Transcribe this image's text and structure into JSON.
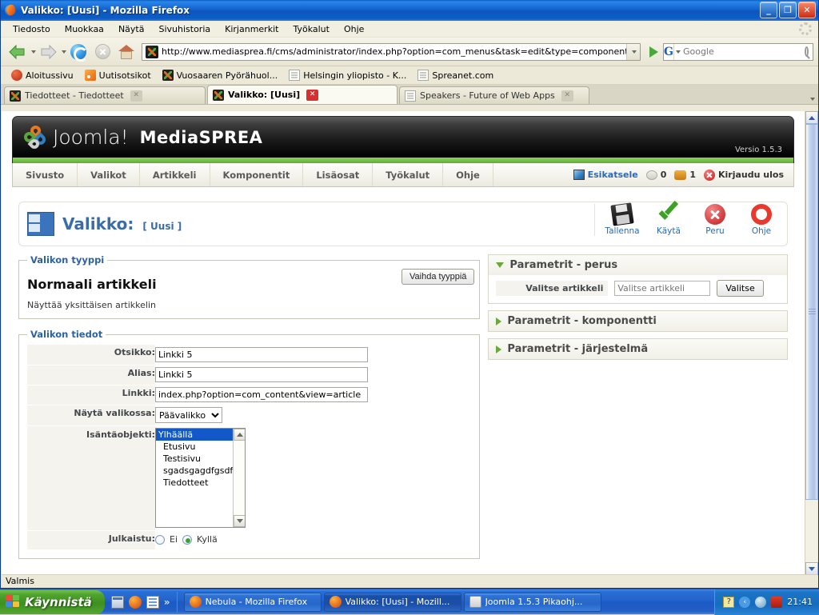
{
  "window": {
    "title": "Valikko: [Uusi] - Mozilla Firefox",
    "minimize": "_",
    "maximize": "❐",
    "close": "✕"
  },
  "menubar": [
    {
      "label": "Tiedosto"
    },
    {
      "label": "Muokkaa"
    },
    {
      "label": "Näytä"
    },
    {
      "label": "Sivuhistoria"
    },
    {
      "label": "Kirjanmerkit"
    },
    {
      "label": "Työkalut"
    },
    {
      "label": "Ohje"
    }
  ],
  "navbar": {
    "back_icon": "back-arrow-icon",
    "forward_icon": "forward-arrow-icon",
    "reload_icon": "reload-icon",
    "stop_icon": "stop-icon",
    "home_icon": "home-icon",
    "url": "http://www.mediasprea.fi/cms/administrator/index.php?option=com_menus&task=edit&type=component&u",
    "go_icon": "go-icon",
    "search_engine": "G",
    "search_placeholder": "Google",
    "search_value": ""
  },
  "bookmarks": [
    {
      "label": "Aloitussivu",
      "icon": "fire-icon"
    },
    {
      "label": "Uutisotsikot",
      "icon": "rss-icon"
    },
    {
      "label": "Vuosaaren Pyörähuol...",
      "icon": "joomla-icon"
    },
    {
      "label": "Helsingin yliopisto - K...",
      "icon": "page-icon"
    },
    {
      "label": "Spreanet.com",
      "icon": "page-icon"
    }
  ],
  "tabs": [
    {
      "label": "Tiedotteet - Tiedotteet",
      "active": false,
      "icon": "joomla-icon"
    },
    {
      "label": "Valikko: [Uusi]",
      "active": true,
      "icon": "joomla-icon"
    },
    {
      "label": "Speakers - Future of Web Apps",
      "active": false,
      "icon": "page-icon"
    }
  ],
  "joomla": {
    "logo_text": "Joomla!",
    "site_name": "MediaSPREA",
    "version": "Versio 1.5.3",
    "nav": [
      {
        "label": "Sivusto"
      },
      {
        "label": "Valikot"
      },
      {
        "label": "Artikkeli"
      },
      {
        "label": "Komponentit"
      },
      {
        "label": "Lisäosat"
      },
      {
        "label": "Työkalut"
      },
      {
        "label": "Ohje"
      }
    ],
    "nav_right": {
      "preview": "Esikatsele",
      "messages_count": "0",
      "users_count": "1",
      "logout": "Kirjaudu ulos"
    },
    "page_title": "Valikko:",
    "page_title_sub": "[ Uusi ]",
    "toolbar": [
      {
        "label": "Tallenna",
        "icon": "save-icon"
      },
      {
        "label": "Käytä",
        "icon": "apply-check-icon"
      },
      {
        "label": "Peru",
        "icon": "cancel-icon"
      },
      {
        "label": "Ohje",
        "icon": "help-icon"
      }
    ],
    "type_fieldset": {
      "legend": "Valikon tyyppi",
      "change_button": "Vaihda tyyppiä",
      "type_name": "Normaali artikkeli",
      "type_desc": "Näyttää yksittäisen artikkelin"
    },
    "details_fieldset": {
      "legend": "Valikon tiedot",
      "fields": {
        "title_label": "Otsikko:",
        "title_value": "Linkki 5",
        "alias_label": "Alias:",
        "alias_value": "Linkki 5",
        "link_label": "Linkki:",
        "link_value": "index.php?option=com_content&view=article",
        "menu_label": "Näytä valikossa:",
        "menu_value": "Päävalikko",
        "parent_label": "Isäntäobjekti:",
        "parent_options": [
          "Ylhäällä",
          "Etusivu",
          "Testisivu",
          "sgadsgagdfgsdfg",
          "Tiedotteet"
        ],
        "parent_selected": "Ylhäällä",
        "published_label": "Julkaistu:",
        "published_no": "Ei",
        "published_yes": "Kyllä",
        "published_value": "Kyllä"
      }
    },
    "params": [
      {
        "title": "Parametrit - perus",
        "expanded": true,
        "row_label": "Valitse artikkeli",
        "row_placeholder": "Valitse artikkeli",
        "row_value": "",
        "row_button": "Valitse"
      },
      {
        "title": "Parametrit - komponentti",
        "expanded": false
      },
      {
        "title": "Parametrit - järjestelmä",
        "expanded": false
      }
    ]
  },
  "statusbar": {
    "text": "Valmis"
  },
  "taskbar": {
    "start_label": "Käynnistä",
    "quicklaunch_overflow": "»",
    "tasks": [
      {
        "label": "Nebula - Mozilla Firefox",
        "icon": "firefox-icon",
        "active": false
      },
      {
        "label": "Valikko: [Uusi] - Mozill...",
        "icon": "firefox-icon",
        "active": true
      },
      {
        "label": "Joomla 1.5.3 Pikaohj...",
        "icon": "word-doc-icon",
        "active": false
      }
    ],
    "tray": [
      "help-icon",
      "show-hidden-icon",
      "disc-icon",
      "security-shield-icon"
    ],
    "clock": "21:41"
  },
  "colors": {
    "titlebar_blue": "#1464cf",
    "joomla_green": "#6aa83c",
    "link_blue": "#2b6ab0",
    "selection_blue": "#1258c8"
  }
}
